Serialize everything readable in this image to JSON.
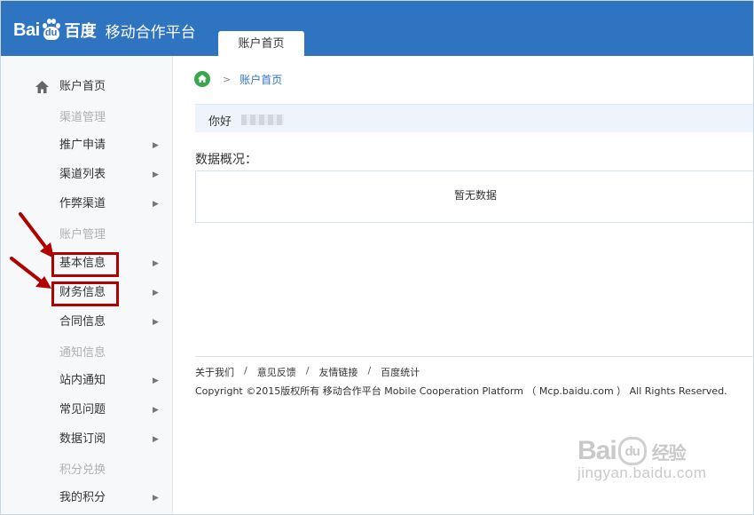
{
  "header": {
    "logo_bai": "Bai",
    "logo_du": "du",
    "logo_paw_text": "du",
    "logo_100": "百度",
    "platform_name": "移动合作平台",
    "active_tab": "账户首页",
    "bg_color": "#2f74c1"
  },
  "sidebar": {
    "home": "账户首页",
    "groups": [
      "渠道管理",
      "账户管理",
      "通知信息",
      "积分兑换"
    ],
    "items": [
      {
        "label": "推广申请"
      },
      {
        "label": "渠道列表"
      },
      {
        "label": "作弊渠道"
      },
      {
        "label": "基本信息"
      },
      {
        "label": "财务信息"
      },
      {
        "label": "合同信息"
      },
      {
        "label": "站内通知"
      },
      {
        "label": "常见问题"
      },
      {
        "label": "数据订阅"
      },
      {
        "label": "我的积分"
      }
    ],
    "highlight_color": "#b00000"
  },
  "breadcrumb": {
    "current": "账户首页"
  },
  "welcome": {
    "greeting": "你好"
  },
  "overview": {
    "title": "数据概况：",
    "empty_text": "暂无数据"
  },
  "footer": {
    "links": [
      "关于我们",
      "意见反馈",
      "友情链接",
      "百度统计"
    ],
    "separator": "/",
    "copyright": "Copyright ©2015版权所有 移动合作平台 Mobile Cooperation Platform （ Mcp.baidu.com ） All Rights Reserved."
  },
  "watermark": {
    "logo_bai": "Bai",
    "logo_du": "du",
    "jingyan": "经验",
    "url": "jingyan.baidu.com"
  }
}
